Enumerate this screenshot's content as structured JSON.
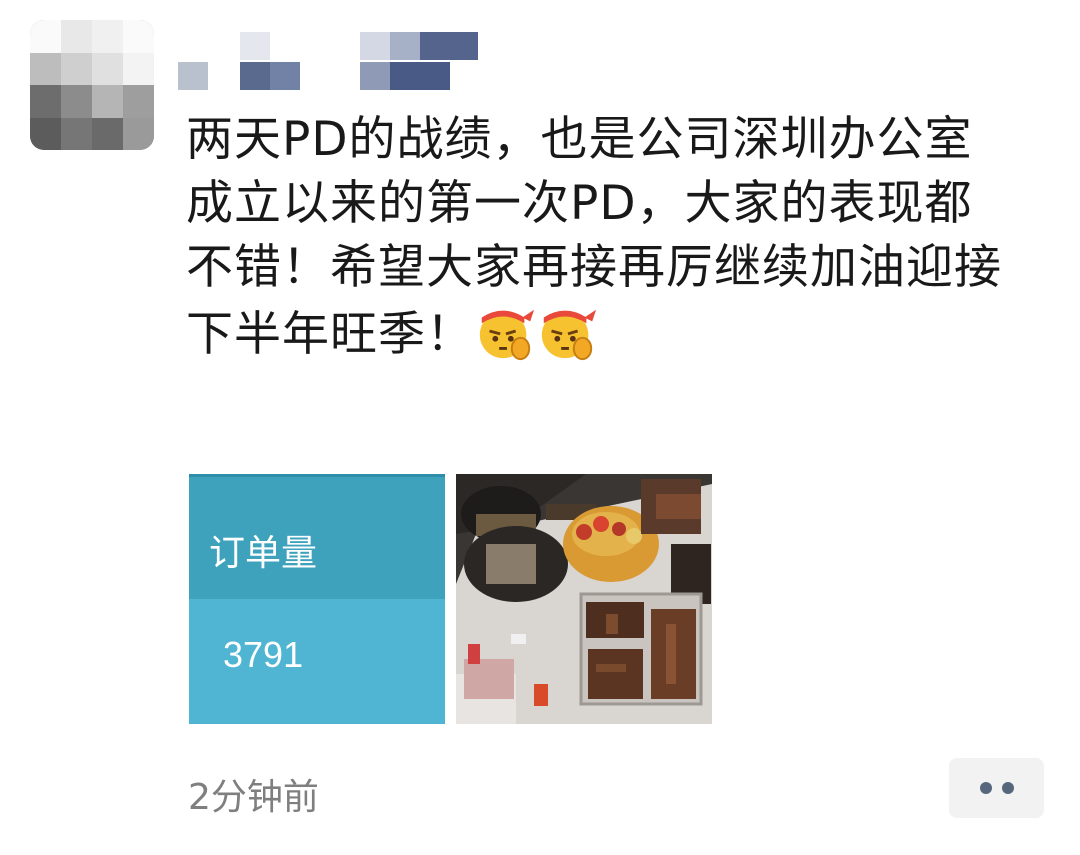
{
  "post": {
    "author_name": "",
    "text": "两天PD的战绩，也是公司深圳办公室成立以来的第一次PD，大家的表现都不错！希望大家再接再厉继续加油迎接下半年旺季！",
    "emojis": [
      "determined-face-emoji",
      "determined-face-emoji"
    ],
    "images": [
      {
        "label": "订单量",
        "value": "3791"
      },
      {
        "description": "food-photo"
      }
    ],
    "timestamp": "2分钟前",
    "more_icon": "ellipsis-icon"
  },
  "colors": {
    "order_header": "#3fa2bd",
    "order_body": "#4fb5d3",
    "timestamp": "#7f7f7f",
    "more_dots": "#56677d"
  }
}
